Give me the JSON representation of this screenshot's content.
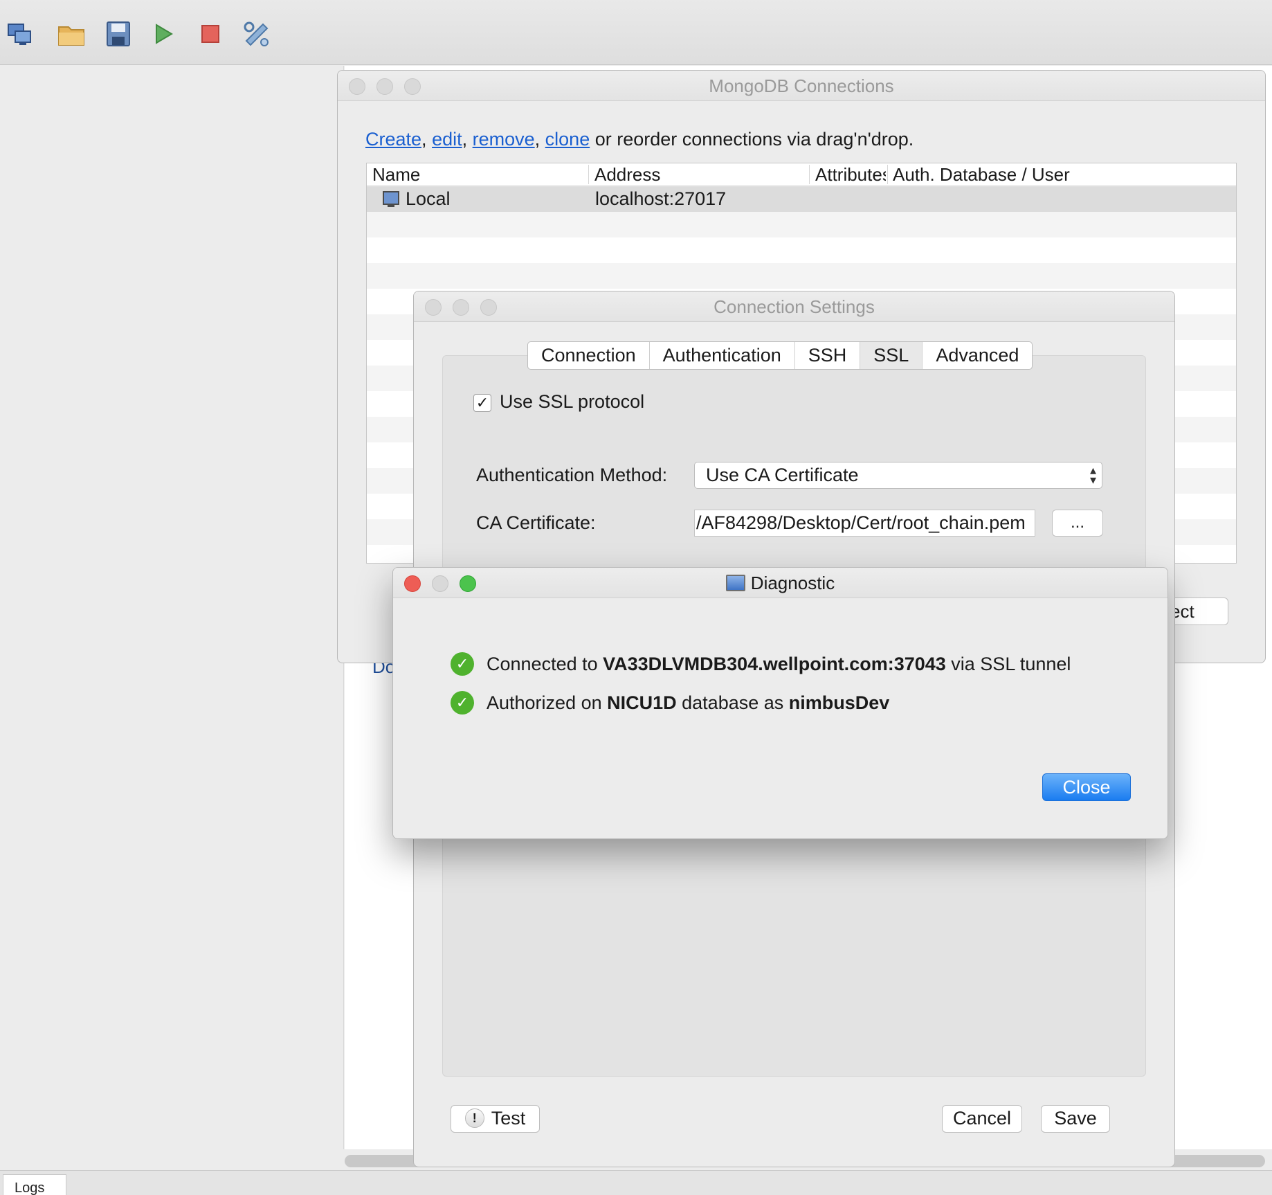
{
  "toolbar": {
    "icons": [
      "connect-icon",
      "open-folder-icon",
      "save-icon",
      "run-icon",
      "stop-icon",
      "tools-icon"
    ]
  },
  "background": {
    "peek_text": "Do",
    "peek_button": "ect",
    "logs_tab": "Logs"
  },
  "mongo_connections": {
    "title": "MongoDB Connections",
    "intro": {
      "create": "Create",
      "edit": "edit",
      "remove": "remove",
      "clone": "clone",
      "rest": " or reorder connections via drag'n'drop.",
      "sep": ", "
    },
    "columns": [
      "Name",
      "Address",
      "Attributes",
      "Auth. Database / User"
    ],
    "rows": [
      {
        "name": "Local",
        "address": "localhost:27017",
        "attributes": "",
        "auth": ""
      }
    ]
  },
  "connection_settings": {
    "title": "Connection Settings",
    "tabs": [
      "Connection",
      "Authentication",
      "SSH",
      "SSL",
      "Advanced"
    ],
    "active_tab": "SSL",
    "use_ssl_label": "Use SSL protocol",
    "use_ssl_checked": true,
    "auth_method_label": "Authentication Method:",
    "auth_method_value": "Use CA Certificate",
    "ca_cert_label": "CA Certificate:",
    "ca_cert_value": "/AF84298/Desktop/Cert/root_chain.pem",
    "browse_label": "...",
    "test_label": "Test",
    "cancel_label": "Cancel",
    "save_label": "Save"
  },
  "diagnostic": {
    "title": "Diagnostic",
    "line1": {
      "prefix": "Connected to ",
      "host": "VA33DLVMDB304.wellpoint.com:37043",
      "suffix": " via SSL tunnel"
    },
    "line2": {
      "prefix": "Authorized on ",
      "database": "NICU1D",
      "middle": " database as ",
      "user": "nimbusDev"
    },
    "close_label": "Close",
    "colors": {
      "ok": "#4fb22e",
      "primary_button": "#1a7cf0"
    }
  }
}
